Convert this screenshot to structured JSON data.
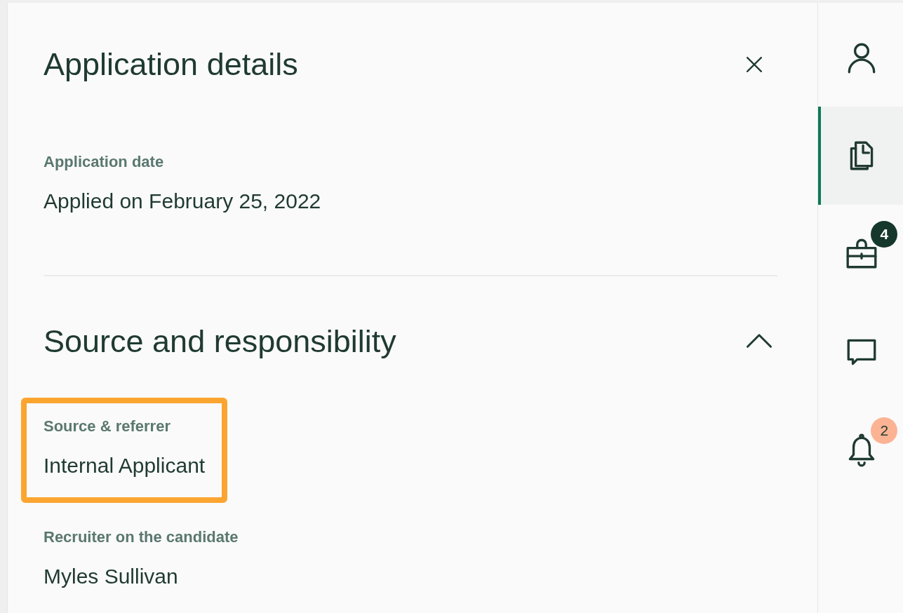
{
  "panel": {
    "title": "Application details",
    "sections": [
      {
        "kind": "plain",
        "fields": [
          {
            "label": "Application date",
            "value": "Applied on February 25, 2022",
            "highlighted": false
          }
        ]
      },
      {
        "kind": "collapsible",
        "heading": "Source and responsibility",
        "expanded": true,
        "fields": [
          {
            "label": "Source & referrer",
            "value": "Internal Applicant",
            "highlighted": true
          },
          {
            "label": "Recruiter on the candidate",
            "value": "Myles Sullivan",
            "highlighted": false
          }
        ]
      }
    ]
  },
  "rail": {
    "items": [
      {
        "kind": "person",
        "selected": false
      },
      {
        "kind": "documents",
        "selected": true
      },
      {
        "kind": "briefcase",
        "selected": false,
        "badge": {
          "text": "4",
          "kind": "dark"
        }
      },
      {
        "kind": "chat",
        "selected": false
      },
      {
        "kind": "bell",
        "selected": false,
        "badge": {
          "text": "2",
          "kind": "alert"
        }
      }
    ]
  }
}
